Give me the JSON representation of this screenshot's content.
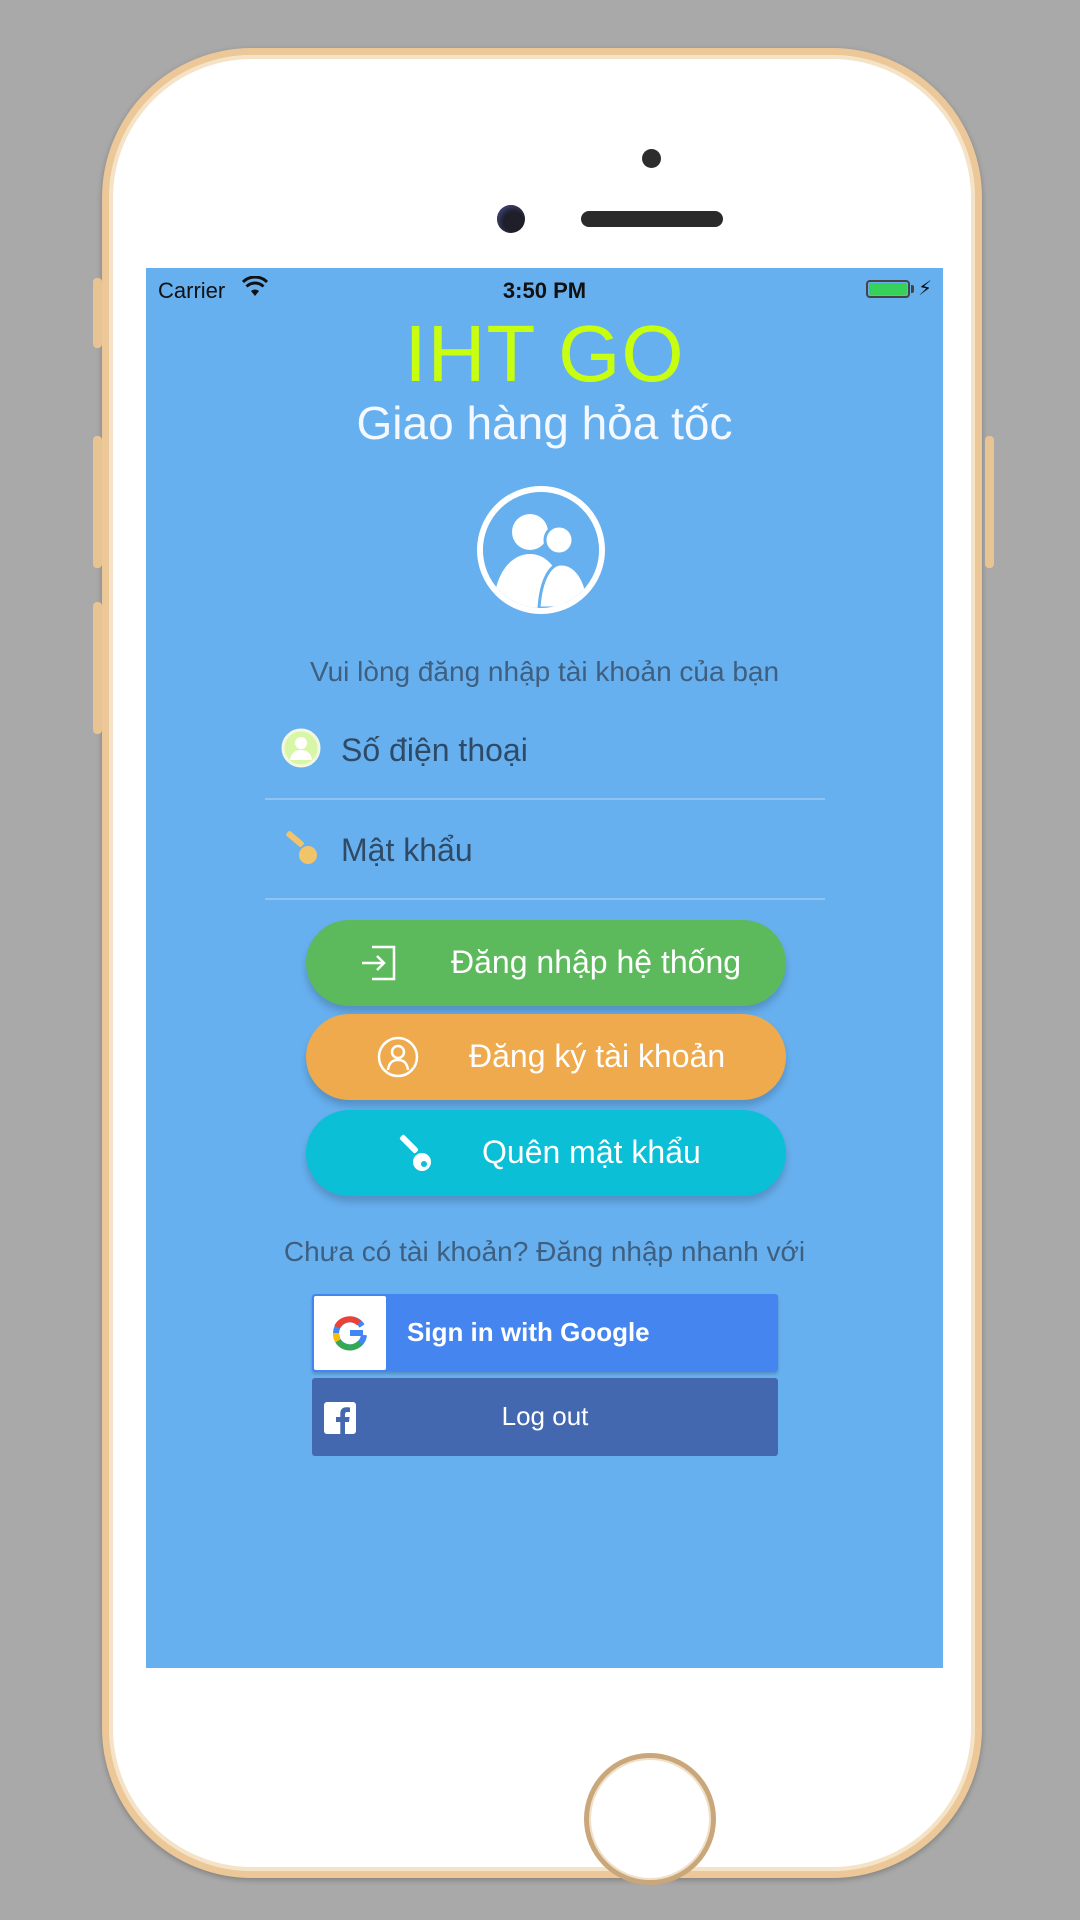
{
  "status_bar": {
    "carrier": "Carrier",
    "time": "3:50 PM",
    "battery_color": "#37d05a"
  },
  "header": {
    "title": "IHT GO",
    "subtitle": "Giao hàng hỏa tốc"
  },
  "login_form": {
    "prompt": "Vui lòng đăng nhập tài khoản của bạn",
    "phone_placeholder": "Số điện thoại",
    "password_placeholder": "Mật khẩu"
  },
  "buttons": {
    "login": "Đăng nhập hệ thống",
    "register": "Đăng ký tài khoản",
    "forgot": "Quên mật khẩu"
  },
  "social": {
    "prompt": "Chưa có tài khoản? Đăng nhập nhanh với",
    "google_label": "Sign in with Google",
    "facebook_label": "Log out"
  },
  "colors": {
    "background": "#67b0f0",
    "title": "#c8ff10",
    "login_button": "#5cba5c",
    "register_button": "#eeaa4c",
    "forgot_button": "#0bbfd6",
    "google_button": "#4585f0",
    "facebook_button": "#4368b0"
  },
  "icons": {
    "avatar": "users-icon",
    "phone_field": "user-icon",
    "password_field": "key-icon",
    "login": "login-icon",
    "register": "user-outline-icon",
    "forgot": "key-icon",
    "google": "google-logo",
    "facebook": "facebook-logo"
  }
}
